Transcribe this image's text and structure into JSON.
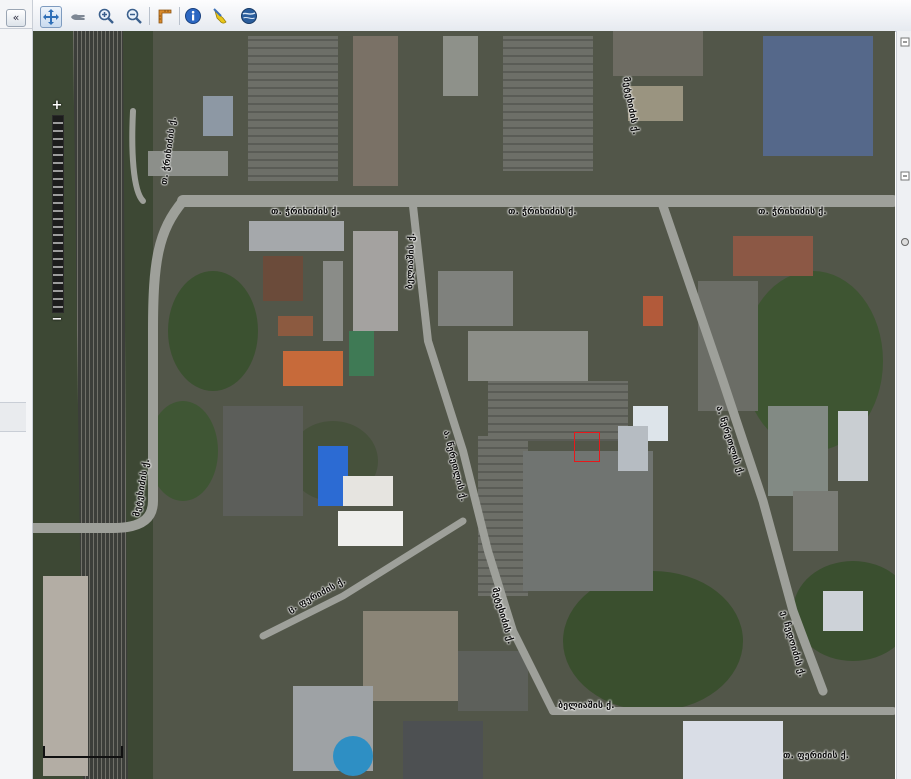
{
  "left_panel": {
    "collapse_label": "«"
  },
  "toolbar": {
    "tools": [
      {
        "name": "pan-tool",
        "icon": "pan-arrows-icon",
        "active": true
      },
      {
        "name": "hand-tool",
        "icon": "hand-icon",
        "active": false
      },
      {
        "name": "zoom-in-tool",
        "icon": "zoom-in-icon",
        "active": false
      },
      {
        "name": "zoom-out-tool",
        "icon": "zoom-out-icon",
        "active": false
      },
      {
        "name": "measure-tool",
        "icon": "ruler-icon",
        "active": false
      },
      {
        "name": "info-tool",
        "icon": "info-icon",
        "active": false
      },
      {
        "name": "clear-tool",
        "icon": "broom-icon",
        "active": false
      },
      {
        "name": "globe-tool",
        "icon": "globe-icon",
        "active": false
      }
    ]
  },
  "map": {
    "zoom_plus": "+",
    "zoom_minus": "−",
    "road_labels": [
      {
        "id": "road-label-1",
        "text": "თ. ჭრიხიძის ქ."
      },
      {
        "id": "road-label-2",
        "text": "თ. ჭრიხიძის ქ."
      },
      {
        "id": "road-label-3",
        "text": "თ. ჭრიხიძის ქ."
      },
      {
        "id": "road-label-4",
        "text": "ბელიაშის ქ."
      },
      {
        "id": "road-label-5",
        "text": "თ. ჭრიხიძის ქ."
      },
      {
        "id": "road-label-6",
        "text": "მეტეხიძის ქ."
      },
      {
        "id": "road-label-7",
        "text": "მეტეხიძის ქ."
      },
      {
        "id": "road-label-8",
        "text": "ც. ფერიძის ქ."
      },
      {
        "id": "road-label-9",
        "text": "ა. წერეთლის ქ."
      },
      {
        "id": "road-label-10",
        "text": "მეტეხიძის ქ."
      },
      {
        "id": "road-label-11",
        "text": "ა. წერეთლის ქ."
      },
      {
        "id": "road-label-12",
        "text": "ე. ჩედოიძის ქ."
      },
      {
        "id": "road-label-13",
        "text": "ბელიაშის ქ."
      },
      {
        "id": "road-label-14",
        "text": "თ. ფერიძის ქ."
      }
    ]
  },
  "colors": {
    "marker": "#e8181b",
    "toolbar_active": "#c9dbef"
  }
}
